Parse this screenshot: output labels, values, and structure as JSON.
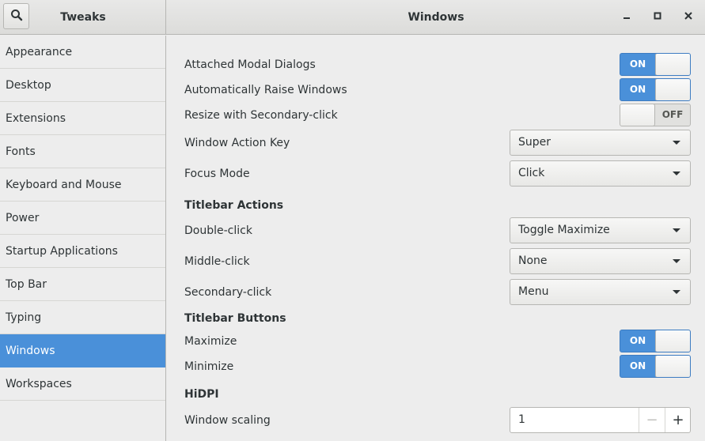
{
  "header": {
    "sidebar_title": "Tweaks",
    "main_title": "Windows",
    "icons": {
      "search": "search-icon",
      "minimize": "minimize-icon",
      "maximize": "maximize-icon",
      "close": "close-icon"
    }
  },
  "sidebar": {
    "items": [
      {
        "label": "Appearance",
        "active": false
      },
      {
        "label": "Desktop",
        "active": false
      },
      {
        "label": "Extensions",
        "active": false
      },
      {
        "label": "Fonts",
        "active": false
      },
      {
        "label": "Keyboard and Mouse",
        "active": false
      },
      {
        "label": "Power",
        "active": false
      },
      {
        "label": "Startup Applications",
        "active": false
      },
      {
        "label": "Top Bar",
        "active": false
      },
      {
        "label": "Typing",
        "active": false
      },
      {
        "label": "Windows",
        "active": true
      },
      {
        "label": "Workspaces",
        "active": false
      }
    ]
  },
  "settings": {
    "attached_modal": {
      "label": "Attached Modal Dialogs",
      "state": "ON"
    },
    "auto_raise": {
      "label": "Automatically Raise Windows",
      "state": "ON"
    },
    "resize_secondary": {
      "label": "Resize with Secondary-click",
      "state": "OFF"
    },
    "action_key": {
      "label": "Window Action Key",
      "value": "Super"
    },
    "focus_mode": {
      "label": "Focus Mode",
      "value": "Click"
    },
    "titlebar_actions": {
      "heading": "Titlebar Actions",
      "double_click": {
        "label": "Double-click",
        "value": "Toggle Maximize"
      },
      "middle_click": {
        "label": "Middle-click",
        "value": "None"
      },
      "secondary_click": {
        "label": "Secondary-click",
        "value": "Menu"
      }
    },
    "titlebar_buttons": {
      "heading": "Titlebar Buttons",
      "maximize": {
        "label": "Maximize",
        "state": "ON"
      },
      "minimize": {
        "label": "Minimize",
        "state": "ON"
      }
    },
    "hidpi": {
      "heading": "HiDPI",
      "window_scaling": {
        "label": "Window scaling",
        "value": "1",
        "minus": "−",
        "plus": "+"
      }
    }
  },
  "colors": {
    "accent": "#4a90d9",
    "background": "#ededed",
    "text": "#2e3436"
  }
}
